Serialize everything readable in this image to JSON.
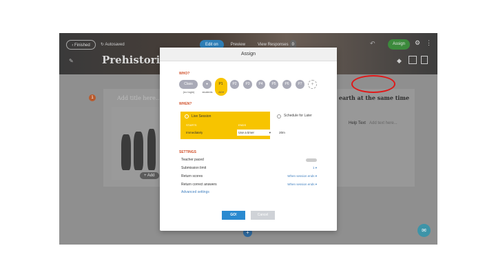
{
  "toolbar": {
    "finished_label": "‹ Finished",
    "autosaved_label": "↻ Autosaved",
    "tabs": [
      {
        "label": "Edit on",
        "active": true
      },
      {
        "label": "Preview",
        "active": false
      },
      {
        "label": "View Responses",
        "count": "0",
        "active": false
      }
    ],
    "assign_label": "Assign"
  },
  "lesson": {
    "title": "Prehistoric",
    "slide_number": "1",
    "slide_title_placeholder": "Add title here...",
    "question_text": "e earth at the same time",
    "help_text_label": "Help Text",
    "help_text_placeholder": "Add text here...",
    "add_label": "+ Add"
  },
  "modal": {
    "title": "Assign",
    "who_title": "WHO?",
    "groups": [
      {
        "label": "Class",
        "sub": "(no login)"
      },
      {
        "label": "",
        "sub": "students",
        "icon": "person-icon"
      },
      {
        "label": "P1",
        "sub": "All ▾",
        "selected": true
      },
      {
        "label": "P2"
      },
      {
        "label": "P3"
      },
      {
        "label": "P4"
      },
      {
        "label": "P5"
      },
      {
        "label": "P6"
      },
      {
        "label": "P7"
      }
    ],
    "add_group": "+",
    "when_title": "WHEN?",
    "live_session_label": "Live Session",
    "starts_caption": "STARTS",
    "ends_caption": "ENDS",
    "starts_value": "Immediately",
    "ends_value": "Use a timer",
    "minutes": "20m",
    "schedule_label": "Schedule for Later",
    "settings_title": "SETTINGS",
    "settings": [
      {
        "label": "Teacher paced",
        "value": "",
        "type": "toggle"
      },
      {
        "label": "Submission limit",
        "value": "1 ▾"
      },
      {
        "label": "Return scores",
        "value": "When session ends ▾"
      },
      {
        "label": "Return correct answers",
        "value": "When session ends ▾"
      }
    ],
    "advanced_label": "Advanced settings",
    "go_label": "GO!",
    "cancel_label": "Cancel"
  },
  "colors": {
    "accent_yellow": "#f7c400",
    "section_orange": "#d0502a",
    "go_blue": "#2a8ad0",
    "annotation_red": "#e01818"
  }
}
